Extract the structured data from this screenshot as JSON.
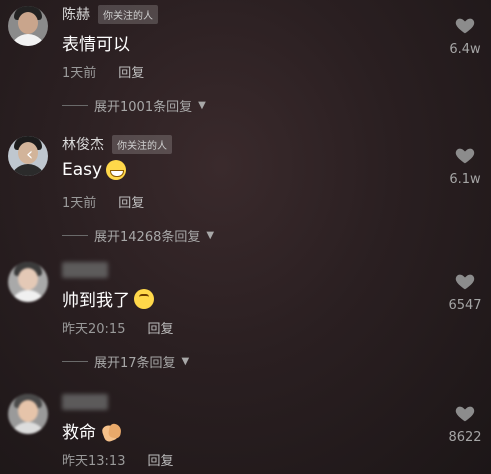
{
  "comments": [
    {
      "name": "陈赫",
      "tag": "你关注的人",
      "text": "表情可以",
      "time": "1天前",
      "reply_label": "回复",
      "expand": "展开1001条回复",
      "likes": "6.4w",
      "emoji": ""
    },
    {
      "name": "林俊杰",
      "tag": "你关注的人",
      "text": "Easy",
      "time": "1天前",
      "reply_label": "回复",
      "expand": "展开14268条回复",
      "likes": "6.1w",
      "emoji": "grinning-face-icon"
    },
    {
      "name": "",
      "tag": "",
      "text": "帅到我了",
      "time": "昨天20:15",
      "reply_label": "回复",
      "expand": "展开17条回复",
      "likes": "6547",
      "emoji": "pleading-face-icon"
    },
    {
      "name": "",
      "tag": "",
      "text": "救命",
      "time": "昨天13:13",
      "reply_label": "回复",
      "expand": "",
      "likes": "8622",
      "emoji": "clapping-hands-icon"
    }
  ],
  "colors": {
    "background": "#2a1f21",
    "secondary_text": "#9a9a9a",
    "tag_background": "rgba(255,255,255,0.18)"
  }
}
